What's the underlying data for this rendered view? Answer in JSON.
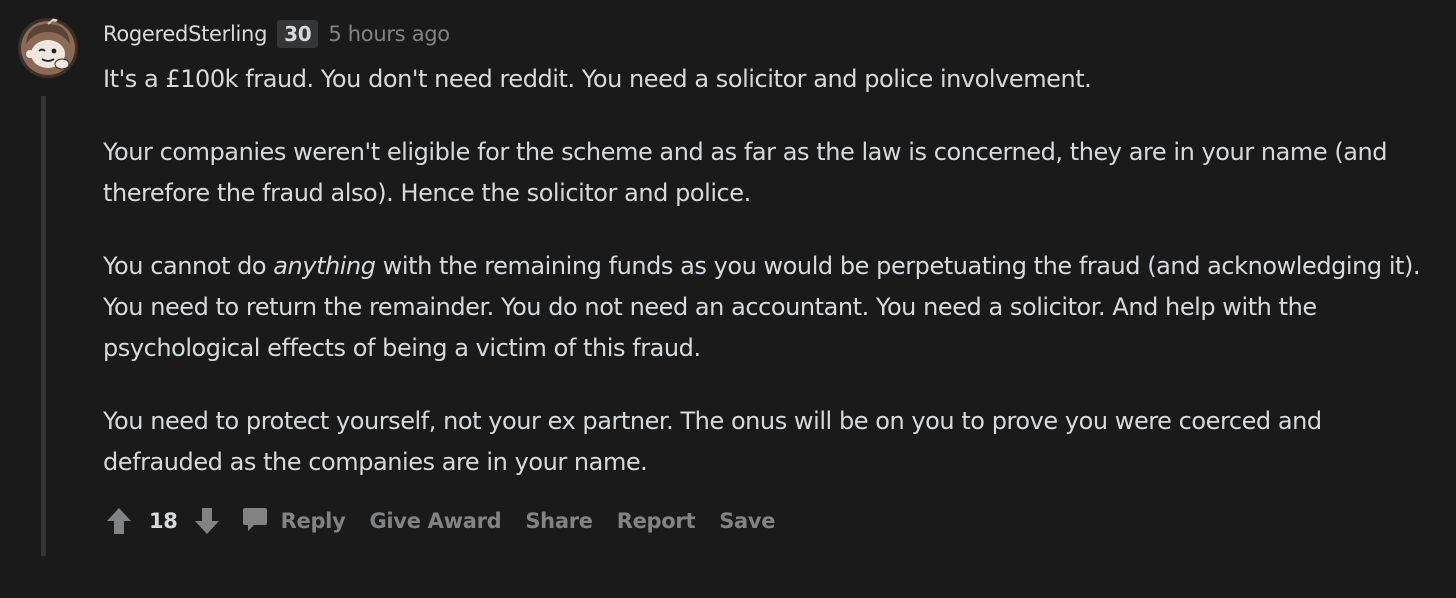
{
  "comment": {
    "author": "RogeredSterling",
    "karma_badge": "30",
    "timestamp": "5 hours ago",
    "paragraphs": [
      {
        "text": "It's a £100k fraud. You don't need reddit. You need a solicitor and police involvement."
      },
      {
        "text": "Your companies weren't eligible for the scheme and as far as the law is concerned, they are in your name (and therefore the fraud also). Hence the solicitor and police."
      },
      {
        "before": "You cannot do ",
        "emphasis": "anything",
        "after": " with the remaining funds as you would be perpetuating the fraud (and acknowledging it). You need to return the remainder. You do not need an accountant. You need a solicitor. And help with the psychological effects of being a victim of this fraud."
      },
      {
        "text": "You need to protect yourself, not your ex partner. The onus will be on you to prove you were coerced and defrauded as the companies are in your name."
      }
    ],
    "score": "18",
    "actions": {
      "reply": "Reply",
      "give_award": "Give Award",
      "share": "Share",
      "report": "Report",
      "save": "Save"
    },
    "icons": {
      "upvote": "arrow-up-icon",
      "downvote": "arrow-down-icon",
      "reply": "speech-bubble-icon",
      "avatar": "snoo-avatar-icon"
    },
    "colors": {
      "background": "#1a1a1b",
      "text": "#d7dadc",
      "muted": "#818384",
      "thread_line": "#343536"
    }
  }
}
